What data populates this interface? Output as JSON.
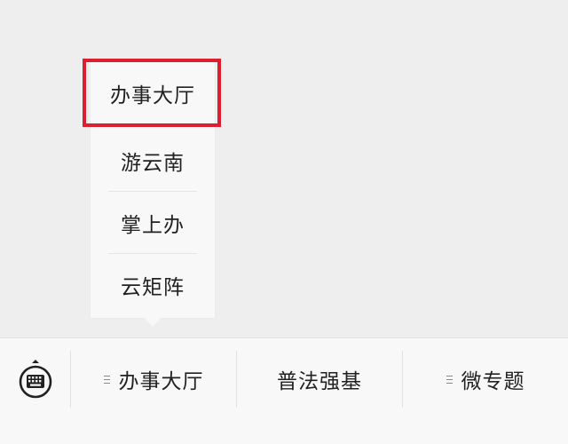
{
  "popup": {
    "items": [
      {
        "label": "办事大厅"
      },
      {
        "label": "游云南"
      },
      {
        "label": "掌上办"
      },
      {
        "label": "云矩阵"
      }
    ],
    "highlighted_index": 0
  },
  "menu_bar": {
    "keyboard_icon": "keyboard-icon",
    "menus": [
      {
        "label": "办事大厅",
        "has_submenu_icon": true
      },
      {
        "label": "普法强基",
        "has_submenu_icon": false
      },
      {
        "label": "微专题",
        "has_submenu_icon": true
      }
    ]
  },
  "colors": {
    "background": "#efeeee",
    "panel": "#f8f8f8",
    "highlight": "#dd1e2f",
    "text": "#222222"
  }
}
